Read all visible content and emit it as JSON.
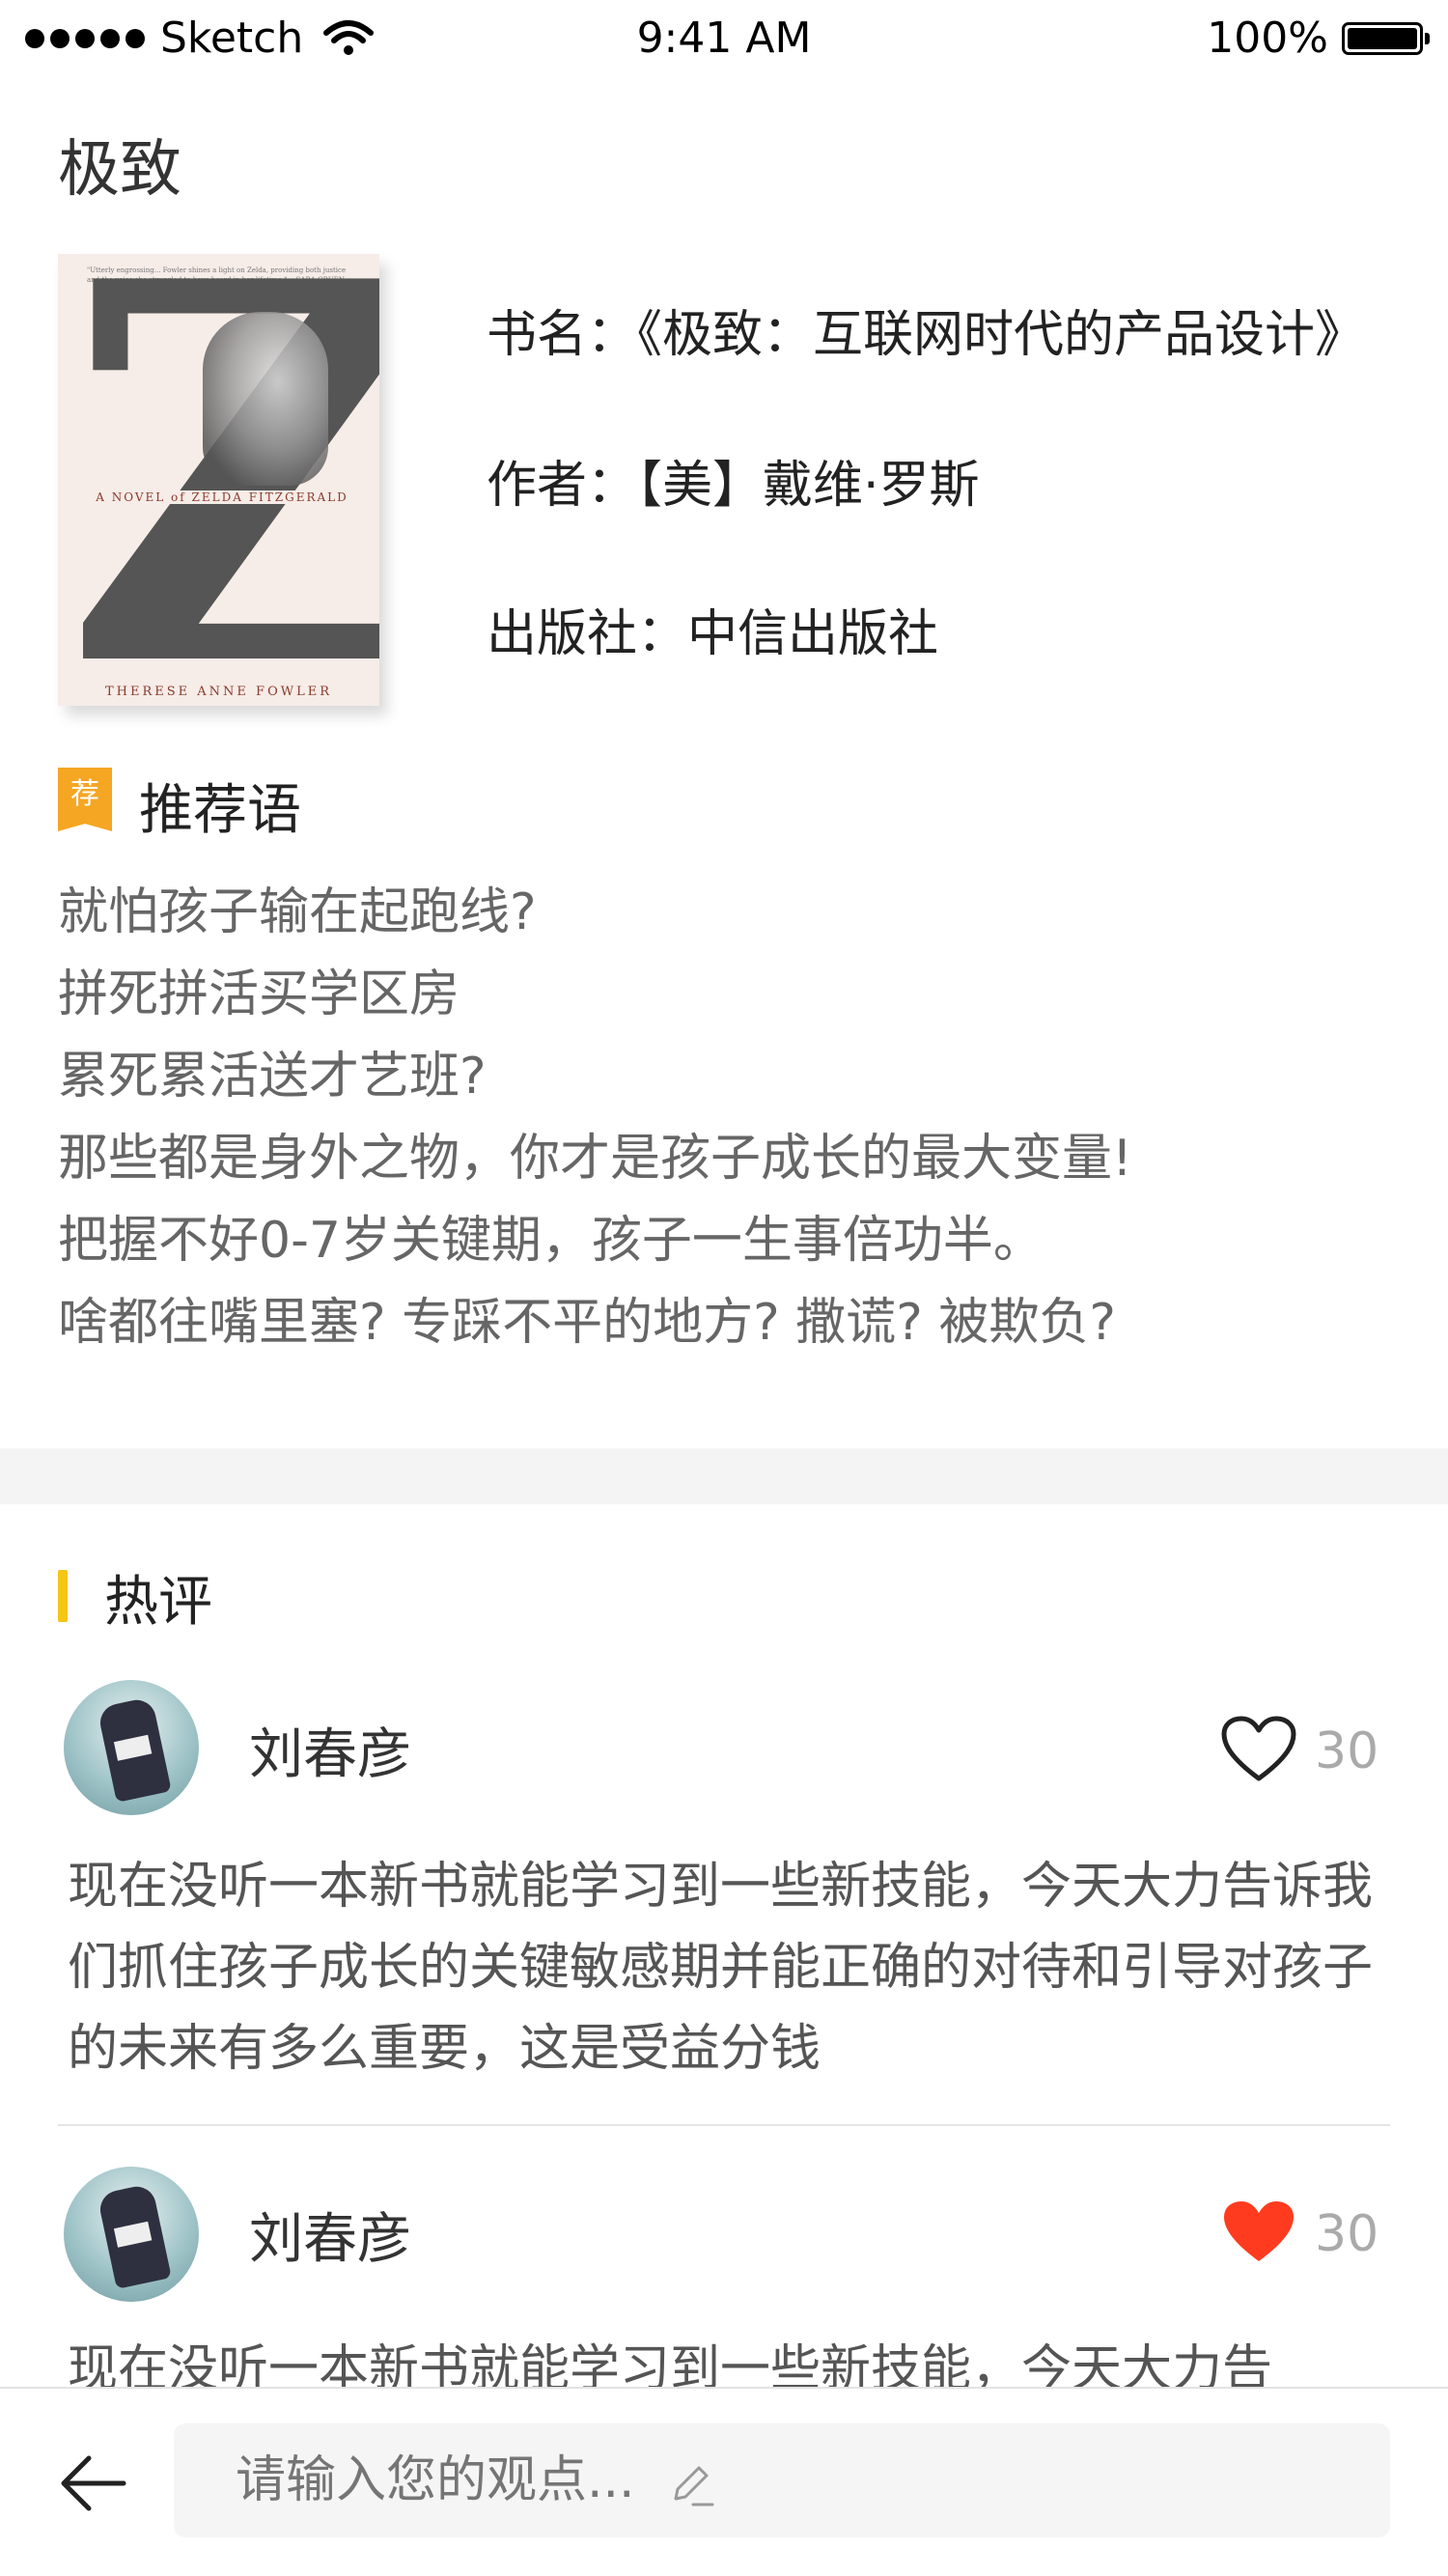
{
  "status_bar": {
    "carrier": "Sketch",
    "time": "9:41 AM",
    "battery": "100%"
  },
  "page_title": "极致",
  "book": {
    "cover": {
      "quote": "\"Utterly engrossing... Fowler shines a light on Zelda, providing both justice and the voice she struggled to have heard in her lifetime.\" —SARA GRUEN",
      "letter": "Z",
      "tagline": "A NOVEL of ZELDA FITZGERALD",
      "author": "THERESE ANNE FOWLER"
    },
    "title_line": "书名：《极致：互联网时代的产品设计》",
    "author_line": "作者：【美】戴维·罗斯",
    "publisher_line": "出版社：中信出版社"
  },
  "recommendation": {
    "tag": "荐",
    "title": "推荐语",
    "lines": [
      "就怕孩子输在起跑线?",
      "拼死拼活买学区房",
      "累死累活送才艺班?",
      "那些都是身外之物，你才是孩子成长的最大变量!",
      "把握不好0-7岁关键期，孩子一生事倍功半。",
      "啥都往嘴里塞? 专踩不平的地方? 撒谎? 被欺负?"
    ]
  },
  "hot_comments": {
    "title": "热评",
    "items": [
      {
        "user": "刘春彦",
        "likes": "30",
        "liked": false,
        "text": "现在没听一本新书就能学习到一些新技能，今天大力告诉我们抓住孩子成长的关键敏感期并能正确的对待和引导对孩子的未来有多么重要，这是受益分钱"
      },
      {
        "user": "刘春彦",
        "likes": "30",
        "liked": true,
        "text": "现在没听一本新书就能学习到一些新技能，今天大力告"
      }
    ]
  },
  "bottom_bar": {
    "placeholder": "请输入您的观点..."
  },
  "colors": {
    "accent": "#f5a623",
    "hot_bar": "#f5c518",
    "liked": "#ff3b1f",
    "divider": "#f4f4f4"
  },
  "icons": [
    "wifi-icon",
    "battery-icon",
    "heart-outline-icon",
    "heart-filled-icon",
    "back-arrow-icon",
    "pencil-icon"
  ]
}
